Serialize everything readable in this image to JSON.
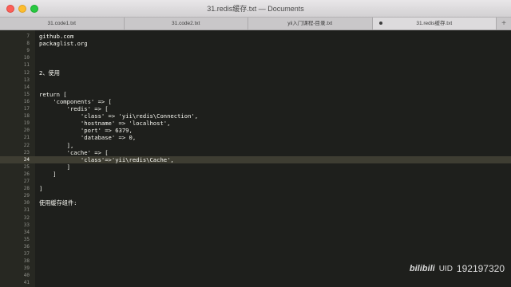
{
  "window": {
    "title": "31.redis缓存.txt — Documents"
  },
  "tabs": [
    {
      "label": "31.code1.txt",
      "active": false,
      "modified": false
    },
    {
      "label": "31.code2.txt",
      "active": false,
      "modified": false
    },
    {
      "label": "yii入门课程-目录.txt",
      "active": false,
      "modified": false
    },
    {
      "label": "31.redis缓存.txt",
      "active": true,
      "modified": true
    }
  ],
  "new_tab_label": "+",
  "editor": {
    "current_line": 24,
    "lines": [
      {
        "num": "7",
        "text": "github.com"
      },
      {
        "num": "8",
        "text": "packaglist.org"
      },
      {
        "num": "9",
        "text": ""
      },
      {
        "num": "10",
        "text": ""
      },
      {
        "num": "11",
        "text": ""
      },
      {
        "num": "12",
        "text": "2、使用"
      },
      {
        "num": "13",
        "text": ""
      },
      {
        "num": "14",
        "text": ""
      },
      {
        "num": "15",
        "text": "return ["
      },
      {
        "num": "16",
        "text": "    'components' => ["
      },
      {
        "num": "17",
        "text": "        'redis' => ["
      },
      {
        "num": "18",
        "text": "            'class' => 'yii\\redis\\Connection',"
      },
      {
        "num": "19",
        "text": "            'hostname' => 'localhost',"
      },
      {
        "num": "20",
        "text": "            'port' => 6379,"
      },
      {
        "num": "21",
        "text": "            'database' => 0,"
      },
      {
        "num": "22",
        "text": "        ],"
      },
      {
        "num": "23",
        "text": "        'cache' => ["
      },
      {
        "num": "24",
        "text": "            'class'=>'yii\\redis\\Cache',"
      },
      {
        "num": "25",
        "text": "        ]"
      },
      {
        "num": "26",
        "text": "    ]"
      },
      {
        "num": "27",
        "text": ""
      },
      {
        "num": "28",
        "text": "]"
      },
      {
        "num": "29",
        "text": ""
      },
      {
        "num": "30",
        "text": "使用缓存组件:"
      },
      {
        "num": "31",
        "text": ""
      },
      {
        "num": "32",
        "text": ""
      },
      {
        "num": "33",
        "text": ""
      },
      {
        "num": "34",
        "text": ""
      },
      {
        "num": "35",
        "text": ""
      },
      {
        "num": "36",
        "text": ""
      },
      {
        "num": "37",
        "text": ""
      },
      {
        "num": "38",
        "text": ""
      },
      {
        "num": "39",
        "text": ""
      },
      {
        "num": "40",
        "text": ""
      },
      {
        "num": "41",
        "text": ""
      }
    ]
  },
  "watermark": {
    "logo": "bilibili",
    "uid_label": "UID",
    "uid": "192197320"
  },
  "colors": {
    "editor_bg": "#1e1f1c",
    "gutter_bg": "#272822",
    "text": "#f8f8f2",
    "line_number": "#8f908a",
    "current_line": "#3e3d32"
  }
}
